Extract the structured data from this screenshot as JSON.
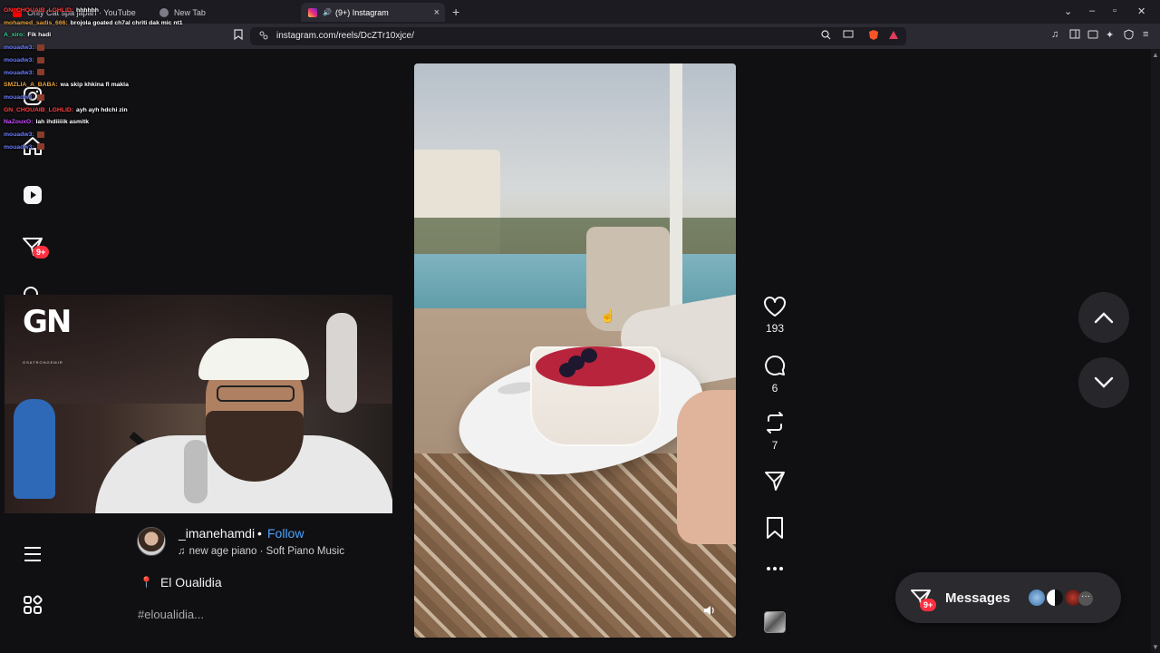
{
  "browser": {
    "tabs": [
      {
        "label": "Only Cat spa japan · YouTube"
      },
      {
        "label": "New Tab"
      },
      {
        "label": "(9+) Instagram"
      }
    ],
    "url": "instagram.com/reels/DcZTr10xjce/",
    "new_tab_symbol": "+",
    "close_symbol": "×"
  },
  "chat": [
    {
      "name": "GN_CHOUAIB_LGHLID:",
      "color": "#ff4040",
      "msg": "hhhhhh"
    },
    {
      "name": "mohamed_sadis_666:",
      "color": "#e8a23c",
      "msg": "brojola goated ch7al chriti dak mic nt1"
    },
    {
      "name": "A_xiro:",
      "color": "#38d38f",
      "msg": "Fik hadi"
    },
    {
      "name": "mouadw3:",
      "color": "#6a7cff",
      "msg": ""
    },
    {
      "name": "mouadw3:",
      "color": "#6a7cff",
      "msg": ""
    },
    {
      "name": "mouadw3:",
      "color": "#6a7cff",
      "msg": ""
    },
    {
      "name": "SMZLIA_A_BABA:",
      "color": "#e8a23c",
      "msg": "wa skip khkina fl makla"
    },
    {
      "name": "mouadw3:",
      "color": "#6a7cff",
      "msg": ""
    },
    {
      "name": "GN_CHOUAIB_LGHLID:",
      "color": "#ff4040",
      "msg": "ayh ayh hdchi zin"
    },
    {
      "name": "NaZouxO:",
      "color": "#c94cff",
      "msg": "lah ihdiiiiik asmitk"
    },
    {
      "name": "mouadw3:",
      "color": "#6a7cff",
      "msg": ""
    },
    {
      "name": "mouadw3:",
      "color": "#6a7cff",
      "msg": ""
    }
  ],
  "sidebar": {
    "notifications_badge": "9+"
  },
  "reel": {
    "author": "_imanehamdi",
    "separator": "•",
    "follow_label": "Follow",
    "audio": "new age piano · Soft Piano Music",
    "location": "El Oualidia",
    "caption": "#eloualidia..."
  },
  "actions": {
    "likes": "193",
    "comments": "6",
    "reposts": "7"
  },
  "messages": {
    "label": "Messages",
    "badge": "9+",
    "more": "···"
  },
  "overlay": {
    "logo": "GN",
    "logo_sub": "GSATRONGEMIR"
  },
  "colors": {
    "accent_blue": "#4aa3ff",
    "badge_red": "#ff3040",
    "page_bg": "#101013"
  }
}
